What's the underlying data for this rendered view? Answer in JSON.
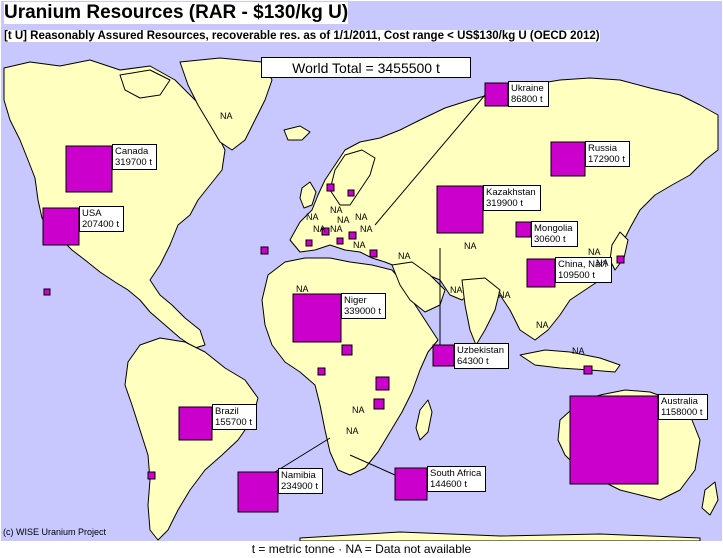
{
  "title": "Uranium Resources (RAR - $130/kg U)",
  "subtitle": "[t U] Reasonably Assured Resources, recoverable res. as of 1/1/2011, Cost range < US$130/kg U  (OECD 2012)",
  "world_total": "World Total = 3455500 t",
  "copyright": "(c) WISE Uranium Project",
  "footer": "t = metric tonne    ·    NA = Data not available",
  "colors": {
    "ocean": "#c8c8ff",
    "land": "#ffffc0",
    "border": "#000000",
    "marker_fill": "#cc00cc",
    "marker_edge": "#000000"
  },
  "countries": [
    {
      "name": "Canada",
      "value": "319700 t"
    },
    {
      "name": "USA",
      "value": "207400 t"
    },
    {
      "name": "Ukraine",
      "value": "86800 t"
    },
    {
      "name": "Russia",
      "value": "172900 t"
    },
    {
      "name": "Kazakhstan",
      "value": "319900 t"
    },
    {
      "name": "Mongolia",
      "value": "30600 t"
    },
    {
      "name": "China, Nat'l",
      "value": "109500 t"
    },
    {
      "name": "Niger",
      "value": "339000 t"
    },
    {
      "name": "Uzbekistan",
      "value": "64300 t"
    },
    {
      "name": "Brazil",
      "value": "155700 t"
    },
    {
      "name": "Australia",
      "value": "1158000 t"
    },
    {
      "name": "Namibia",
      "value": "234900 t"
    },
    {
      "name": "South Africa",
      "value": "144600 t"
    }
  ],
  "na_label": "NA"
}
